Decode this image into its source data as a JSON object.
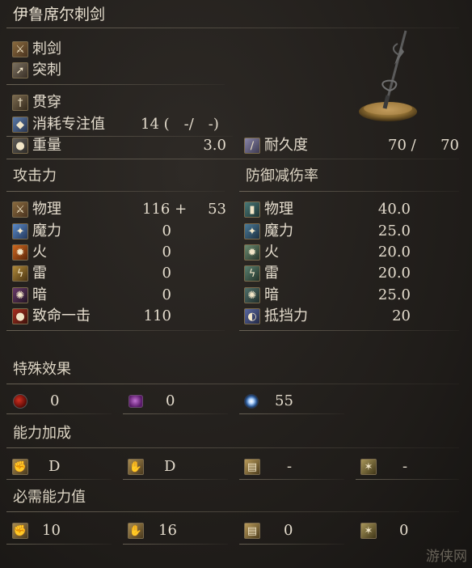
{
  "title": "伊鲁席尔刺剑",
  "weapon_type": "刺剑",
  "attack_type": "突刺",
  "skill": "贯穿",
  "fp_cost": {
    "label": "消耗专注值",
    "value": "14 (　-/　-)"
  },
  "weight": {
    "label": "重量",
    "value": "3.0"
  },
  "durability": {
    "label": "耐久度",
    "current": "70 /",
    "max": "70"
  },
  "attack_header": "攻击力",
  "defense_header": "防御减伤率",
  "attack": [
    {
      "label": "物理",
      "value": "116 +",
      "bonus": "53"
    },
    {
      "label": "魔力",
      "value": "0"
    },
    {
      "label": "火",
      "value": "0"
    },
    {
      "label": "雷",
      "value": "0"
    },
    {
      "label": "暗",
      "value": "0"
    },
    {
      "label": "致命一击",
      "value": "110"
    }
  ],
  "defense": [
    {
      "label": "物理",
      "value": "40.0"
    },
    {
      "label": "魔力",
      "value": "25.0"
    },
    {
      "label": "火",
      "value": "20.0"
    },
    {
      "label": "雷",
      "value": "20.0"
    },
    {
      "label": "暗",
      "value": "25.0"
    },
    {
      "label": "抵挡力",
      "value": "20"
    }
  ],
  "special_header": "特殊效果",
  "special": [
    {
      "icon": "bleed-icon",
      "value": "0"
    },
    {
      "icon": "poison-icon",
      "value": "0"
    },
    {
      "icon": "frost-icon",
      "value": "55"
    }
  ],
  "scaling_header": "能力加成",
  "scaling": [
    {
      "icon": "strength-icon",
      "value": "D"
    },
    {
      "icon": "dexterity-icon",
      "value": "D"
    },
    {
      "icon": "intelligence-icon",
      "value": "-"
    },
    {
      "icon": "faith-icon",
      "value": "-"
    }
  ],
  "requirements_header": "必需能力值",
  "requirements": [
    {
      "icon": "strength-icon",
      "value": "10"
    },
    {
      "icon": "dexterity-icon",
      "value": "16"
    },
    {
      "icon": "intelligence-icon",
      "value": "0"
    },
    {
      "icon": "faith-icon",
      "value": "0"
    }
  ],
  "watermark": "游侠网"
}
